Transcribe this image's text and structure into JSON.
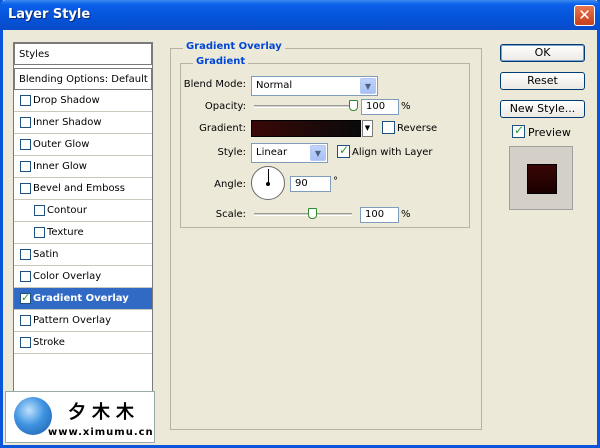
{
  "window": {
    "title": "Layer Style",
    "close_glyph": "✕"
  },
  "styles_list": {
    "header": "Styles",
    "blending": "Blending Options: Default",
    "items": [
      {
        "label": "Drop Shadow",
        "checked": false,
        "sub": false
      },
      {
        "label": "Inner Shadow",
        "checked": false,
        "sub": false
      },
      {
        "label": "Outer Glow",
        "checked": false,
        "sub": false
      },
      {
        "label": "Inner Glow",
        "checked": false,
        "sub": false
      },
      {
        "label": "Bevel and Emboss",
        "checked": false,
        "sub": false
      },
      {
        "label": "Contour",
        "checked": false,
        "sub": true
      },
      {
        "label": "Texture",
        "checked": false,
        "sub": true
      },
      {
        "label": "Satin",
        "checked": false,
        "sub": false
      },
      {
        "label": "Color Overlay",
        "checked": false,
        "sub": false
      },
      {
        "label": "Gradient Overlay",
        "checked": true,
        "sub": false,
        "selected": true
      },
      {
        "label": "Pattern Overlay",
        "checked": false,
        "sub": false
      },
      {
        "label": "Stroke",
        "checked": false,
        "sub": false
      }
    ]
  },
  "gradient_overlay": {
    "section_title": "Gradient Overlay",
    "group_title": "Gradient",
    "blend_mode": {
      "label": "Blend Mode:",
      "value": "Normal"
    },
    "opacity": {
      "label": "Opacity:",
      "value": "100",
      "unit": "%",
      "level": 1.0
    },
    "gradient": {
      "label": "Gradient:",
      "reverse_label": "Reverse",
      "reverse_checked": false,
      "colors": [
        "#3a0808",
        "#0a0a0a"
      ]
    },
    "style": {
      "label": "Style:",
      "value": "Linear",
      "align_label": "Align with Layer",
      "align_checked": true
    },
    "angle": {
      "label": "Angle:",
      "value": "90",
      "unit": "°"
    },
    "scale": {
      "label": "Scale:",
      "value": "100",
      "unit": "%",
      "level": 0.6
    }
  },
  "buttons": {
    "ok": "OK",
    "reset": "Reset",
    "new_style": "New Style...",
    "preview_label": "Preview",
    "preview_checked": true
  },
  "watermark": {
    "logo_text": "夕木木",
    "url": "www.ximumu.cn"
  }
}
